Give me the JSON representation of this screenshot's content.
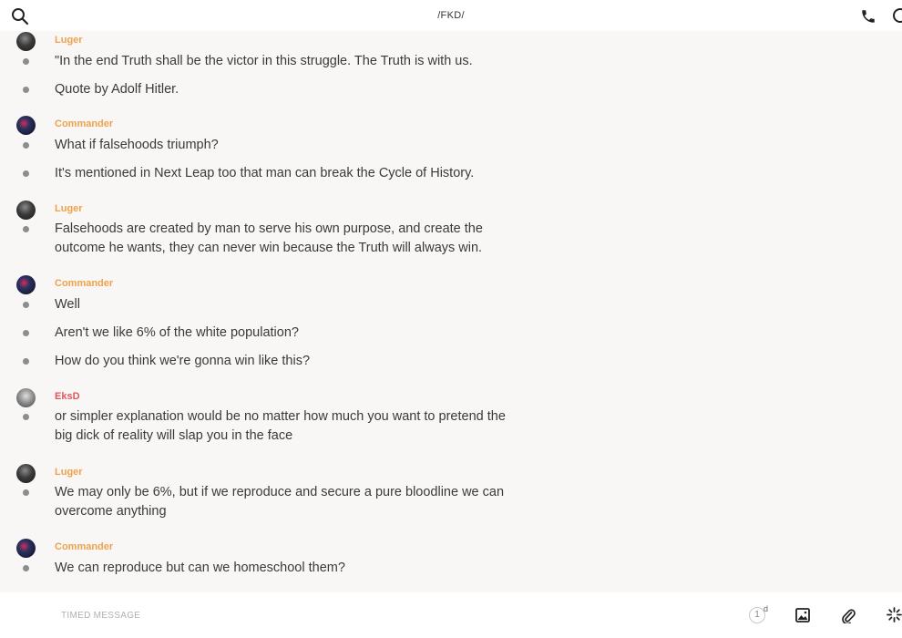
{
  "header": {
    "title": "/FKD/"
  },
  "messages": [
    {
      "sender": "Luger",
      "sender_color": "#f0a14b",
      "avatar": "luger-avatar",
      "lines": [
        "\"In the end Truth shall be the victor in this struggle. The Truth is with us.",
        "Quote by Adolf Hitler."
      ]
    },
    {
      "sender": "Commander",
      "sender_color": "#f0a14b",
      "avatar": "commander-avatar",
      "lines": [
        "What if falsehoods triumph?",
        "It's mentioned in Next Leap too that man can break the Cycle of History."
      ]
    },
    {
      "sender": "Luger",
      "sender_color": "#f0a14b",
      "avatar": "luger-avatar",
      "lines": [
        "Falsehoods are created by man to serve his own purpose, and create the outcome he wants, they can never win because the Truth will always win."
      ]
    },
    {
      "sender": "Commander",
      "sender_color": "#f0a14b",
      "avatar": "commander-avatar",
      "lines": [
        "Well",
        "Aren't we like 6% of the white population?",
        "How do you think we're gonna win like this?"
      ]
    },
    {
      "sender": "EksD",
      "sender_color": "#e0575b",
      "avatar": "eksd-avatar",
      "lines": [
        "or simpler explanation would be no matter how much you want to pretend the big dick of reality will slap you in the face"
      ]
    },
    {
      "sender": "Luger",
      "sender_color": "#f0a14b",
      "avatar": "luger-avatar",
      "lines": [
        "We may only be 6%, but if we reproduce and secure a pure bloodline we can overcome anything"
      ]
    },
    {
      "sender": "Commander",
      "sender_color": "#f0a14b",
      "avatar": "commander-avatar",
      "lines": [
        "We can reproduce but can we homeschool them?"
      ]
    }
  ],
  "composer": {
    "placeholder": "TIMED MESSAGE",
    "timer_value": "1",
    "timer_unit": "d"
  },
  "icons": {
    "search": "search-icon",
    "call": "phone-icon",
    "info": "info-icon",
    "image": "image-icon",
    "attach": "paperclip-icon",
    "sparkle": "sparkle-icon"
  }
}
